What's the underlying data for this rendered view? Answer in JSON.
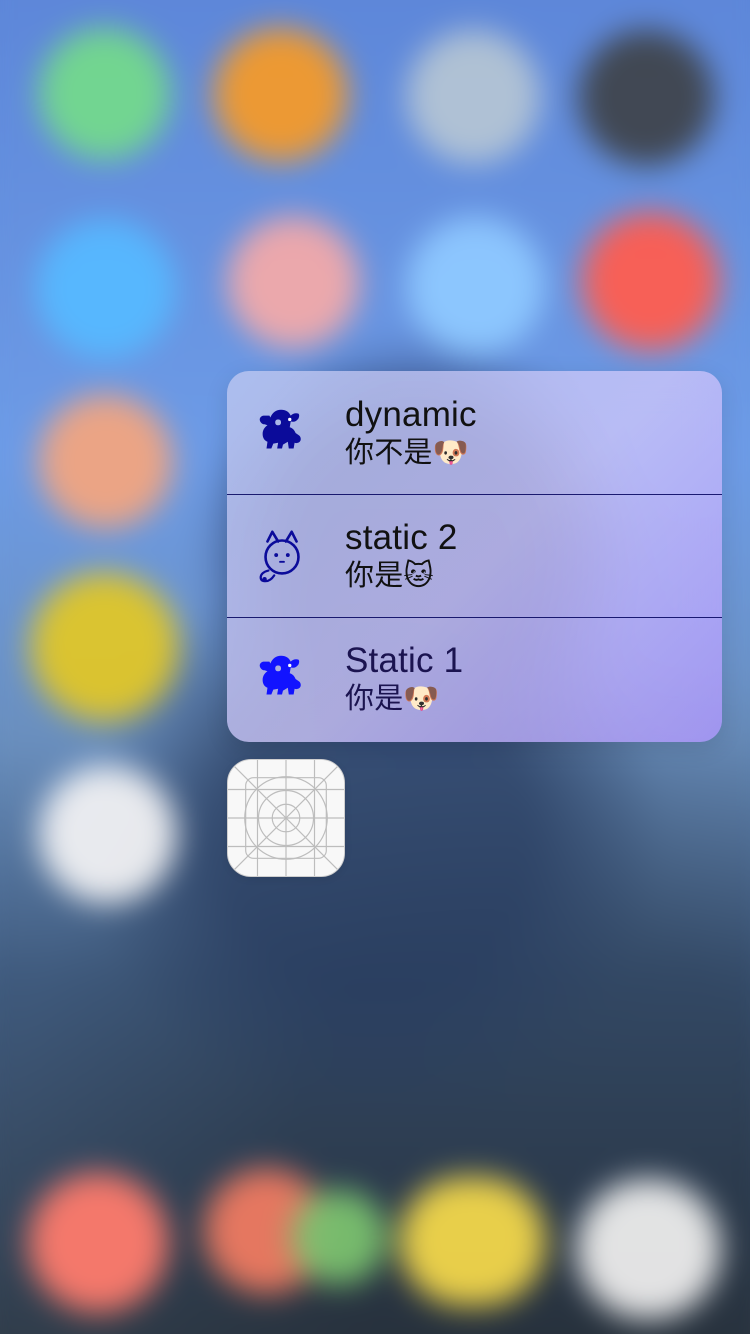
{
  "quick_actions": [
    {
      "title": "dynamic",
      "subtitle": "你不是🐶",
      "icon": "dog-icon"
    },
    {
      "title": "static 2",
      "subtitle": "你是🐱",
      "icon": "cat-icon"
    },
    {
      "title": "Static 1",
      "subtitle": "你是🐶",
      "icon": "dog-icon"
    }
  ],
  "app": {
    "icon": "app-template-grid-icon"
  },
  "colors": {
    "menu_text": "#111111",
    "menu_icon": "#0b0b9a",
    "menu_divider": "#00005a"
  }
}
